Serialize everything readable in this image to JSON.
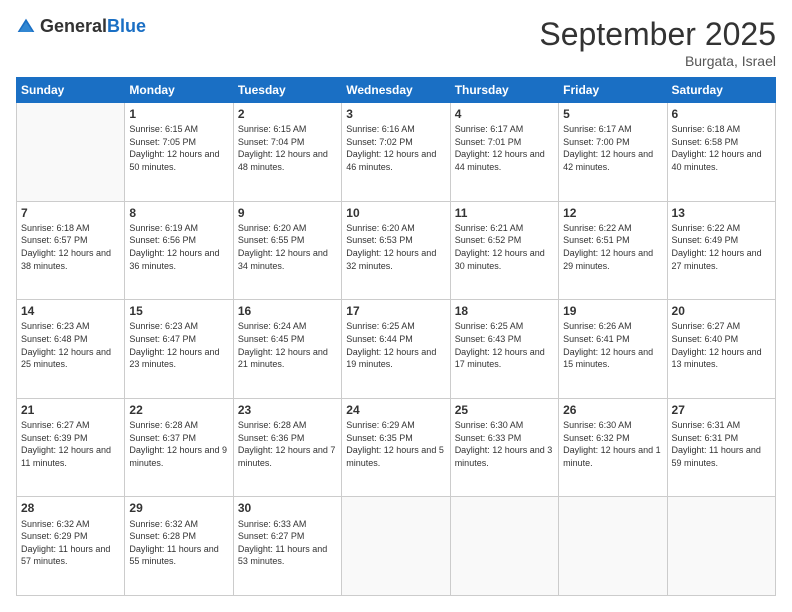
{
  "logo": {
    "general": "General",
    "blue": "Blue"
  },
  "header": {
    "month": "September 2025",
    "location": "Burgata, Israel"
  },
  "weekdays": [
    "Sunday",
    "Monday",
    "Tuesday",
    "Wednesday",
    "Thursday",
    "Friday",
    "Saturday"
  ],
  "weeks": [
    [
      {
        "day": null
      },
      {
        "day": 1,
        "sunrise": "6:15 AM",
        "sunset": "7:05 PM",
        "daylight": "12 hours and 50 minutes."
      },
      {
        "day": 2,
        "sunrise": "6:15 AM",
        "sunset": "7:04 PM",
        "daylight": "12 hours and 48 minutes."
      },
      {
        "day": 3,
        "sunrise": "6:16 AM",
        "sunset": "7:02 PM",
        "daylight": "12 hours and 46 minutes."
      },
      {
        "day": 4,
        "sunrise": "6:17 AM",
        "sunset": "7:01 PM",
        "daylight": "12 hours and 44 minutes."
      },
      {
        "day": 5,
        "sunrise": "6:17 AM",
        "sunset": "7:00 PM",
        "daylight": "12 hours and 42 minutes."
      },
      {
        "day": 6,
        "sunrise": "6:18 AM",
        "sunset": "6:58 PM",
        "daylight": "12 hours and 40 minutes."
      }
    ],
    [
      {
        "day": 7,
        "sunrise": "6:18 AM",
        "sunset": "6:57 PM",
        "daylight": "12 hours and 38 minutes."
      },
      {
        "day": 8,
        "sunrise": "6:19 AM",
        "sunset": "6:56 PM",
        "daylight": "12 hours and 36 minutes."
      },
      {
        "day": 9,
        "sunrise": "6:20 AM",
        "sunset": "6:55 PM",
        "daylight": "12 hours and 34 minutes."
      },
      {
        "day": 10,
        "sunrise": "6:20 AM",
        "sunset": "6:53 PM",
        "daylight": "12 hours and 32 minutes."
      },
      {
        "day": 11,
        "sunrise": "6:21 AM",
        "sunset": "6:52 PM",
        "daylight": "12 hours and 30 minutes."
      },
      {
        "day": 12,
        "sunrise": "6:22 AM",
        "sunset": "6:51 PM",
        "daylight": "12 hours and 29 minutes."
      },
      {
        "day": 13,
        "sunrise": "6:22 AM",
        "sunset": "6:49 PM",
        "daylight": "12 hours and 27 minutes."
      }
    ],
    [
      {
        "day": 14,
        "sunrise": "6:23 AM",
        "sunset": "6:48 PM",
        "daylight": "12 hours and 25 minutes."
      },
      {
        "day": 15,
        "sunrise": "6:23 AM",
        "sunset": "6:47 PM",
        "daylight": "12 hours and 23 minutes."
      },
      {
        "day": 16,
        "sunrise": "6:24 AM",
        "sunset": "6:45 PM",
        "daylight": "12 hours and 21 minutes."
      },
      {
        "day": 17,
        "sunrise": "6:25 AM",
        "sunset": "6:44 PM",
        "daylight": "12 hours and 19 minutes."
      },
      {
        "day": 18,
        "sunrise": "6:25 AM",
        "sunset": "6:43 PM",
        "daylight": "12 hours and 17 minutes."
      },
      {
        "day": 19,
        "sunrise": "6:26 AM",
        "sunset": "6:41 PM",
        "daylight": "12 hours and 15 minutes."
      },
      {
        "day": 20,
        "sunrise": "6:27 AM",
        "sunset": "6:40 PM",
        "daylight": "12 hours and 13 minutes."
      }
    ],
    [
      {
        "day": 21,
        "sunrise": "6:27 AM",
        "sunset": "6:39 PM",
        "daylight": "12 hours and 11 minutes."
      },
      {
        "day": 22,
        "sunrise": "6:28 AM",
        "sunset": "6:37 PM",
        "daylight": "12 hours and 9 minutes."
      },
      {
        "day": 23,
        "sunrise": "6:28 AM",
        "sunset": "6:36 PM",
        "daylight": "12 hours and 7 minutes."
      },
      {
        "day": 24,
        "sunrise": "6:29 AM",
        "sunset": "6:35 PM",
        "daylight": "12 hours and 5 minutes."
      },
      {
        "day": 25,
        "sunrise": "6:30 AM",
        "sunset": "6:33 PM",
        "daylight": "12 hours and 3 minutes."
      },
      {
        "day": 26,
        "sunrise": "6:30 AM",
        "sunset": "6:32 PM",
        "daylight": "12 hours and 1 minute."
      },
      {
        "day": 27,
        "sunrise": "6:31 AM",
        "sunset": "6:31 PM",
        "daylight": "11 hours and 59 minutes."
      }
    ],
    [
      {
        "day": 28,
        "sunrise": "6:32 AM",
        "sunset": "6:29 PM",
        "daylight": "11 hours and 57 minutes."
      },
      {
        "day": 29,
        "sunrise": "6:32 AM",
        "sunset": "6:28 PM",
        "daylight": "11 hours and 55 minutes."
      },
      {
        "day": 30,
        "sunrise": "6:33 AM",
        "sunset": "6:27 PM",
        "daylight": "11 hours and 53 minutes."
      },
      {
        "day": null
      },
      {
        "day": null
      },
      {
        "day": null
      },
      {
        "day": null
      }
    ]
  ]
}
